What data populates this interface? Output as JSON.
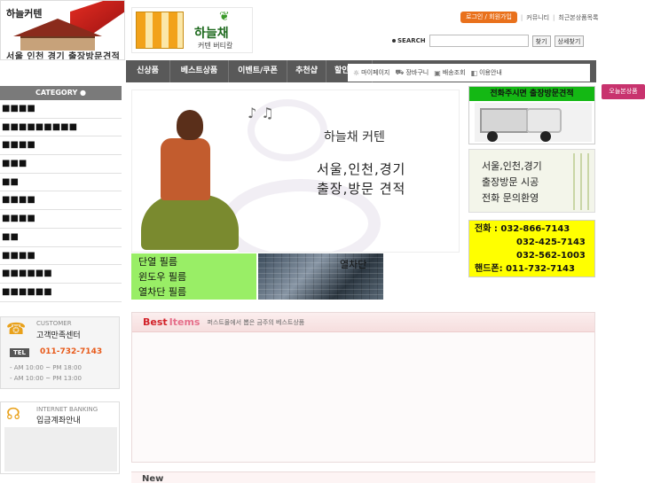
{
  "header": {
    "logo_brand": "하늘커텐",
    "logo_sub": "서울 인천 경기 출장방문견적",
    "brand_name": "하늘채",
    "brand_tag": "커텐 버티칼",
    "login_label": "로그인 / 회원가입",
    "community_label": "커뮤니티",
    "recent_label": "최근본상품목록",
    "search_label": "SEARCH",
    "search_value": "",
    "search_button": "찾기",
    "detail_search_button": "상세찾기"
  },
  "nav": {
    "items": [
      "신상품",
      "베스트상품",
      "이벤트/쿠폰",
      "추천샵",
      "할인상품"
    ]
  },
  "util": {
    "items": [
      "마이페이지",
      "장바구니",
      "배송조회",
      "이용안내"
    ]
  },
  "side_tab": "오늘본상품",
  "sidebar": {
    "category_title": "CATEGORY",
    "categories": [
      "■■■■",
      "■■■■■■■■■",
      "■■■■",
      "■■■",
      "■■",
      "■■■■",
      "■■■■",
      "■■",
      "■■■■",
      "■■■■■■",
      "■■■■■■"
    ]
  },
  "customer": {
    "en": "CUSTOMER",
    "ko": "고객만족센터",
    "tel_label": "TEL",
    "tel": "011-732-7143",
    "hours1": "- AM 10:00 ~ PM 18:00",
    "hours2": "- AM 10:00 ~ PM 13:00"
  },
  "bank": {
    "en": "INTERNET BANKING",
    "ko": "입금계좌안내"
  },
  "banner": {
    "title": "하늘채 커텐",
    "line1": "서울,인천,경기",
    "line2": "출장,방문 견적"
  },
  "films": {
    "green": [
      "단열 필름",
      "윈도우 필름",
      "열차단 필름"
    ],
    "building": "열차단"
  },
  "right": {
    "visit_banner": "전화주시면 출장방문견적",
    "service_lines": [
      "서울,인천,경기",
      "출장방문 시공",
      "전화 문의환영"
    ],
    "phones": [
      "전화 :  032-866-7143",
      "032-425-7143",
      "032-562-1003",
      "핸드폰: 011-732-7143"
    ]
  },
  "best": {
    "title_best": "Best",
    "title_items": "Items",
    "desc": "퍼스트몰에서 뽑은 금주의 베스트상품"
  },
  "new_items": {
    "title": "New"
  }
}
